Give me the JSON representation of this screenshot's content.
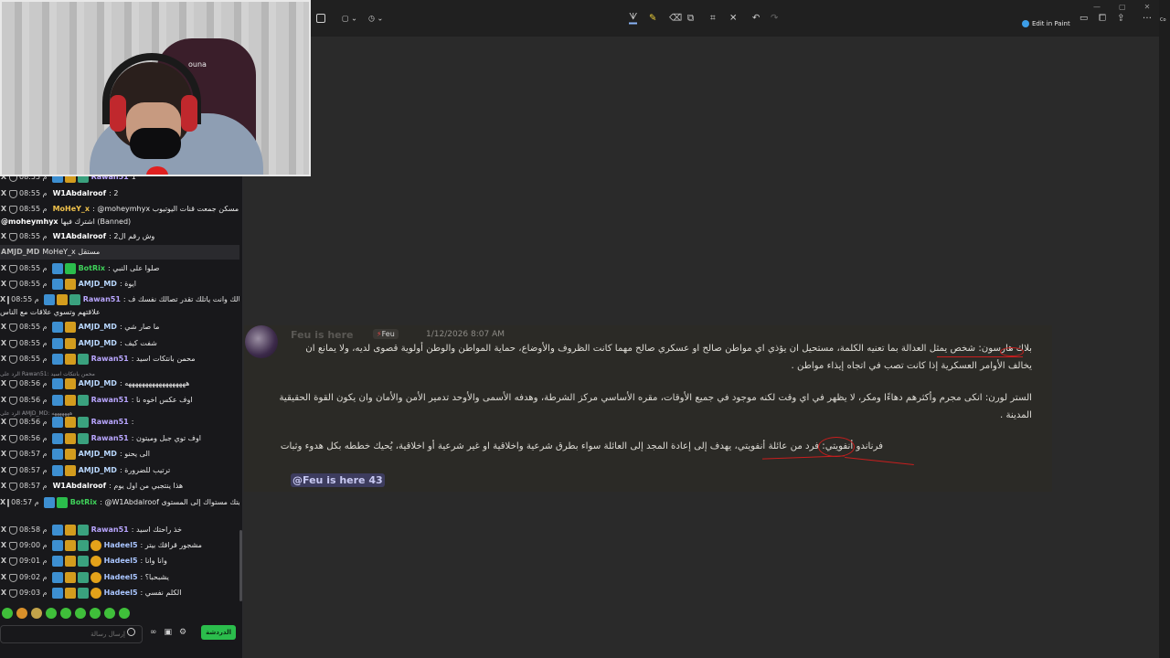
{
  "chat": {
    "messages": [
      {
        "time": "08:55 م",
        "user": "Rawan51",
        "color": "#b9a6ff",
        "text": "1",
        "badges": [
          "b1",
          "b3",
          "b2"
        ]
      },
      {
        "time": "08:55 م",
        "user": "W1Abdalroof",
        "color": "#ffffff",
        "text": ": 2",
        "badges": []
      },
      {
        "time": "08:55 م",
        "user": "MoHeY_x",
        "color": "#f0c24c",
        "text": ": @moheymhyx مسكن جمعت قنات اليوتيوب",
        "badges": []
      },
      {
        "time": "",
        "user": "@moheymhyx",
        "color": "#ffffff",
        "text": "اشترك فيها (Banned)",
        "badges": []
      },
      {
        "time": "08:55 م",
        "user": "W1Abdalroof",
        "color": "#ffffff",
        "text": ": وش رقم ال2",
        "badges": []
      },
      {
        "time": "",
        "user": "AMJD_MD",
        "color": "#b9b9b9",
        "text": "MoHeY_x مستقل",
        "badges": []
      },
      {
        "time": "08:55 م",
        "user": "BotRix",
        "color": "#3fd25a",
        "text": ": صلوا على النبي",
        "badges": [
          "b1",
          "b4"
        ]
      },
      {
        "time": "08:55 م",
        "user": "AMJD_MD",
        "color": "#b9d8ff",
        "text": ": ايوة",
        "badges": [
          "b1",
          "b3"
        ]
      },
      {
        "time": "08:55 م",
        "user": "Rawan51",
        "color": "#b9a6ff",
        "text": ": ويل تالك وانت ياتلك تقدر تصالك نفسك ف",
        "badges": [
          "b1",
          "b3",
          "b2"
        ]
      },
      {
        "time": "",
        "user": "",
        "color": "#ffffff",
        "text": "علاقتهم وتسوي علاقات مع الناس",
        "badges": []
      },
      {
        "time": "08:55 م",
        "user": "AMJD_MD",
        "color": "#b9d8ff",
        "text": ": ما صار شي",
        "badges": [
          "b1",
          "b3"
        ]
      },
      {
        "time": "08:55 م",
        "user": "AMJD_MD",
        "color": "#b9d8ff",
        "text": ": شفت كيف",
        "badges": [
          "b1",
          "b3"
        ]
      },
      {
        "time": "08:55 م",
        "user": "Rawan51",
        "color": "#b9a6ff",
        "text": ": محمن بانتكات اسيد",
        "badges": [
          "b1",
          "b3",
          "b2"
        ]
      },
      {
        "time": "",
        "user": "",
        "color": "#8f8f95",
        "text": "الرد على Rawan51: محمن بانتكات اسيد",
        "badges": []
      },
      {
        "time": "08:56 م",
        "user": "AMJD_MD",
        "color": "#b9d8ff",
        "text": ": ههههههههههههههههههه",
        "badges": [
          "b1",
          "b3"
        ]
      },
      {
        "time": "08:56 م",
        "user": "Rawan51",
        "color": "#b9a6ff",
        "text": ": اوف عكس اخوه نا",
        "badges": [
          "b1",
          "b3",
          "b2"
        ]
      },
      {
        "time": "",
        "user": "",
        "color": "#8f8f95",
        "text": "الرد على AMJD_MD: هههههههه",
        "badges": []
      },
      {
        "time": "08:56 م",
        "user": "Rawan51",
        "color": "#b9a6ff",
        "text": ":",
        "badges": [
          "b1",
          "b3",
          "b2"
        ]
      },
      {
        "time": "08:56 م",
        "user": "Rawan51",
        "color": "#b9a6ff",
        "text": ": اوف توي جبل وميتون",
        "badges": [
          "b1",
          "b3",
          "b2"
        ]
      },
      {
        "time": "08:57 م",
        "user": "AMJD_MD",
        "color": "#b9d8ff",
        "text": ": الى يحنو",
        "badges": [
          "b1",
          "b3"
        ]
      },
      {
        "time": "08:57 م",
        "user": "AMJD_MD",
        "color": "#b9d8ff",
        "text": ": ترتيب للضرورة",
        "badges": [
          "b1",
          "b3"
        ]
      },
      {
        "time": "08:57 م",
        "user": "W1Abdalroof",
        "color": "#ffffff",
        "text": ": هذا ينتجبي من اول يوم",
        "badges": []
      },
      {
        "time": "08:57 م",
        "user": "BotRix",
        "color": "#3fd25a",
        "text": ": @W1Abdalroof تمت ترقيتك مستواك إلى المستوى",
        "badges": [
          "b1",
          "b4"
        ]
      },
      {
        "time": "08:58 م",
        "user": "Rawan51",
        "color": "#b9a6ff",
        "text": ": خذ راحتك اسيد",
        "badges": [
          "b1",
          "b3",
          "b2"
        ]
      },
      {
        "time": "09:00 م",
        "user": "Hadeel5",
        "color": "#a9c5ff",
        "text": ": مشجور قراقك بيتر",
        "badges": [
          "b1",
          "b3",
          "b2",
          "b5"
        ]
      },
      {
        "time": "09:01 م",
        "user": "Hadeel5",
        "color": "#a9c5ff",
        "text": ": وانا وانا",
        "badges": [
          "b1",
          "b3",
          "b2",
          "b5"
        ]
      },
      {
        "time": "09:02 م",
        "user": "Hadeel5",
        "color": "#a9c5ff",
        "text": ": يشبحبا؟",
        "badges": [
          "b1",
          "b3",
          "b2",
          "b5"
        ]
      },
      {
        "time": "09:03 م",
        "user": "Hadeel5",
        "color": "#a9c5ff",
        "text": ": الكلم نفسي",
        "badges": [
          "b1",
          "b3",
          "b2",
          "b5"
        ]
      }
    ],
    "input_placeholder": "إرسال رسالة",
    "send_label": "الدردشة"
  },
  "toolbar": {
    "edit_in_paint": "Edit in Paint"
  },
  "right_strip": "Co",
  "message": {
    "author": "Feu is here",
    "role_label": "Feu",
    "timestamp": "1/12/2026 8:07 AM",
    "lines": [
      "بلاك هارسون: شخص يمثل العدالة بما تعنيه الكلمة، مستحيل ان يؤذي اي مواطن صالح او عسكري صالح مهما كانت الظروف والأوضاع، حماية المواطن والوطن أولوية قصوى لديه، ولا يمانع ان",
      "يخالف الأوامر العسكرية إذا كانت تصب في اتجاه إيذاء مواطن .",
      "الستر لورن: انكى مجرم وأكثرهم دهاءًا ومكر، لا يظهر في اي وقت لكنه موجود في جميع الأوقات، مقره الأساسي مركز الشرطة، وهدفه الأسمى والأوحد تدمير الأمن والأمان وان يكون القوة الحقيقية",
      "المدينة .",
      "فرناندو أنفويتي: فرد من عائلة أنفويتي، يهدف إلى إعادة المجد إلى العائلة سواء بطرق شرعية واخلاقية او غير شرعية أو اخلاقية، يُحيك خططه بكل هدوء وثبات"
    ],
    "mention": "@Feu is here 43"
  }
}
